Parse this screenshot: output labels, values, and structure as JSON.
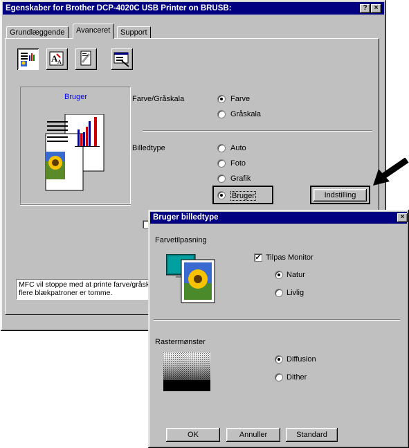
{
  "main_window": {
    "title": "Egenskaber for Brother DCP-4020C USB Printer on BRUSB:",
    "help_btn": "?",
    "close_btn": "×",
    "tabs": [
      {
        "label": "Grundlæggende"
      },
      {
        "label": "Avanceret"
      },
      {
        "label": "Support"
      }
    ],
    "toolbar_icons": [
      "color-quality-icon",
      "scaling-icon",
      "watermark-icon",
      "device-options-icon"
    ],
    "preview_label": "Bruger",
    "color_group": {
      "label": "Farve/Gråskala",
      "options": [
        {
          "label": "Farve",
          "selected": true
        },
        {
          "label": "Gråskala",
          "selected": false
        }
      ]
    },
    "image_type_group": {
      "label": "Billedtype",
      "options": [
        {
          "label": "Auto",
          "selected": false
        },
        {
          "label": "Foto",
          "selected": false
        },
        {
          "label": "Grafik",
          "selected": false
        },
        {
          "label": "Bruger",
          "selected": true
        }
      ]
    },
    "settings_button": "Indstilling",
    "status_text": "MFC vil stoppe med at printe farve/gråsk flere blækpatroner er tomme."
  },
  "dialog": {
    "title": "Bruger billedtype",
    "close_btn": "×",
    "color_matching": {
      "label": "Farvetilpasning",
      "checkbox_label": "Tilpas Monitor",
      "checkbox_checked": true,
      "options": [
        {
          "label": "Natur",
          "selected": true
        },
        {
          "label": "Livlig",
          "selected": false
        }
      ]
    },
    "halftone": {
      "label": "Rastermønster",
      "options": [
        {
          "label": "Diffusion",
          "selected": true
        },
        {
          "label": "Dither",
          "selected": false
        }
      ]
    },
    "buttons": {
      "ok": "OK",
      "cancel": "Annuller",
      "default": "Standard"
    }
  },
  "colors": {
    "titlebar": "#000080",
    "face": "#c0c0c0",
    "link": "#0000ff"
  }
}
